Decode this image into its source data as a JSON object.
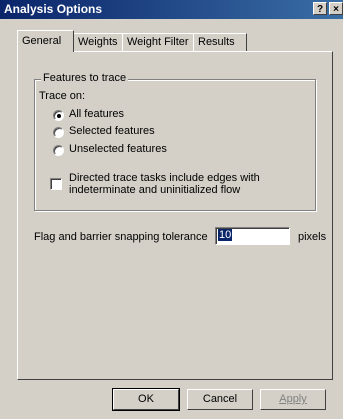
{
  "window": {
    "title": "Analysis Options",
    "help_glyph": "?",
    "close_glyph": "×"
  },
  "tabs": [
    "General",
    "Weights",
    "Weight Filter",
    "Results"
  ],
  "active_tab": "General",
  "features_group": {
    "legend": "Features to trace",
    "trace_on_label": "Trace on:",
    "options": [
      "All features",
      "Selected features",
      "Unselected features"
    ],
    "selected": "All features",
    "directed_checkbox": {
      "line1": "Directed trace tasks include edges with",
      "line2": "indeterminate and uninitialized flow",
      "checked": false
    }
  },
  "tolerance": {
    "label": "Flag and barrier snapping tolerance",
    "value": "10",
    "unit": "pixels"
  },
  "buttons": {
    "ok": "OK",
    "cancel": "Cancel",
    "apply": "Apply"
  },
  "colors": {
    "title_bar_start": "#0a246a",
    "title_bar_end": "#3a6ea5",
    "dialog_bg": "#d4d0c8",
    "disabled_text": "#808080"
  }
}
